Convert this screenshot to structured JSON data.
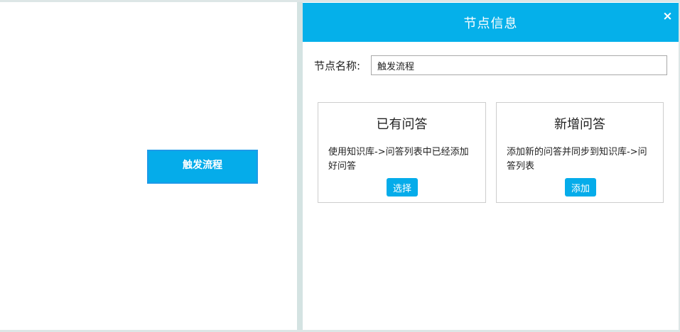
{
  "canvas": {
    "node_label": "触发流程"
  },
  "panel": {
    "title": "节点信息",
    "close_glyph": "×",
    "name_label": "节点名称:",
    "name_value": "触发流程",
    "cards": [
      {
        "title": "已有问答",
        "description": "使用知识库->问答列表中已经添加好问答",
        "button_label": "选择"
      },
      {
        "title": "新增问答",
        "description": "添加新的问答并同步到知识库->问答列表",
        "button_label": "添加"
      }
    ]
  },
  "colors": {
    "accent": "#05b0ea",
    "node_border": "#1e9ae8",
    "divider": "#d4e3e2"
  },
  "icons": {
    "close": "close-icon"
  }
}
